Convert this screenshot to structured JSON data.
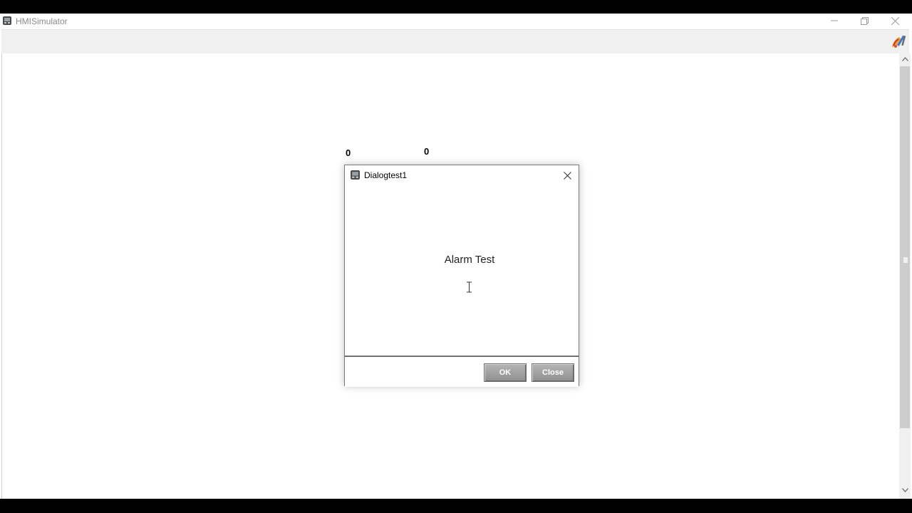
{
  "app": {
    "title": "HMISimulator",
    "icon": "hmi-app-icon"
  },
  "window_controls": {
    "minimize_icon": "minimize-icon",
    "restore_icon": "restore-icon",
    "close_icon": "close-icon"
  },
  "toolbar": {
    "tool_icon": "paint-tools-icon"
  },
  "canvas": {
    "labels": [
      "0",
      "0"
    ]
  },
  "dialog": {
    "title": "Dialogtest1",
    "message": "Alarm Test",
    "ok_label": "OK",
    "close_label": "Close"
  },
  "colors": {
    "button_gray": "#9e9e9e",
    "frame_black": "#000000"
  }
}
